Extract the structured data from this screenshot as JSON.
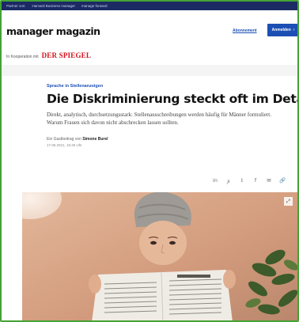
{
  "topbar": {
    "items": [
      "Partner von:",
      "Harvard Business manager",
      "manage forward"
    ]
  },
  "header": {
    "logo": "manager magazin",
    "subscribe_label": "Abonnement",
    "login_label": "Anmelden",
    "login_arrow": "›"
  },
  "cooperation": {
    "label": "In Kooperation mit",
    "partner": "DER SPIEGEL"
  },
  "article": {
    "kicker": "Sprache in Stellenanzeigen",
    "headline": "Die Diskriminierung steckt oft im Detail",
    "teaser": "Direkt, analytisch, durchsetzungsstark: Stellenausschreibungen werden häufig für Männer formuliert. Warum Frauen sich davon nicht abschrecken lassen sollten.",
    "byline_prefix": "Ein Gastbeitrag von",
    "author": "Simone Burel",
    "date": "17.06.2021, 19.26 Uhr"
  },
  "share": {
    "icons": [
      "linkedin-icon",
      "xing-icon",
      "twitter-icon",
      "facebook-icon",
      "mail-icon",
      "link-icon"
    ],
    "glyphs": [
      "in",
      "ꭗ",
      "𝕥",
      "f",
      "✉",
      "🔗"
    ]
  },
  "media": {
    "expand_glyph": "⤢"
  },
  "colors": {
    "frame": "#45a335",
    "topbar": "#1b2a63",
    "accent": "#1b4fb3",
    "spiegel_red": "#d0121b"
  }
}
